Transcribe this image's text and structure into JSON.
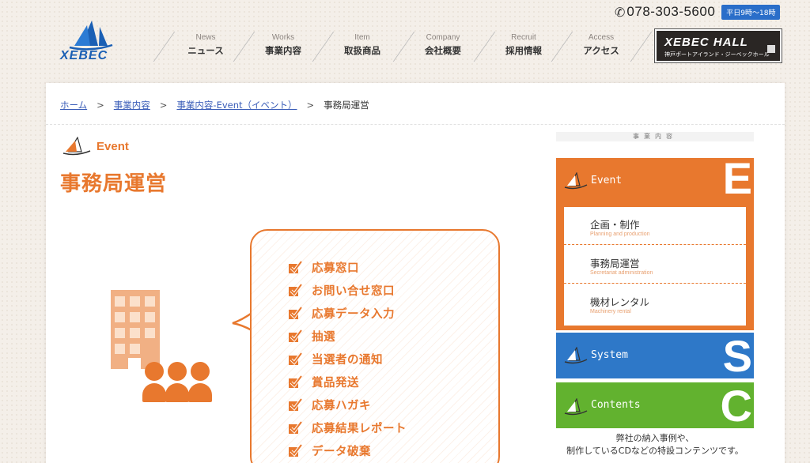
{
  "header": {
    "logo_text": "XEBEC",
    "phone": "078-303-5600",
    "hours": "平日9時～18時",
    "nav": [
      {
        "en": "News",
        "jp": "ニュース"
      },
      {
        "en": "Works",
        "jp": "事業内容"
      },
      {
        "en": "Item",
        "jp": "取扱商品"
      },
      {
        "en": "Company",
        "jp": "会社概要"
      },
      {
        "en": "Recruit",
        "jp": "採用情報"
      },
      {
        "en": "Access",
        "jp": "アクセス"
      }
    ],
    "hall": {
      "title": "XEBEC HALL",
      "sub": "神戸ポートアイランド・ジーベックホール"
    }
  },
  "breadcrumb": {
    "items": [
      "ホーム",
      "事業内容",
      "事業内容-Event（イベント）"
    ],
    "current": "事務局運営",
    "separator": ">"
  },
  "main": {
    "category": "Event",
    "title": "事務局運営",
    "checklist": [
      "応募窓口",
      "お問い合せ窓口",
      "応募データ入力",
      "抽選",
      "当選者の通知",
      "賞品発送",
      "応募ハガキ",
      "応募結果レポート",
      "データ破棄"
    ]
  },
  "sidebar": {
    "heading": "事業内容",
    "event": {
      "label": "Event",
      "letter": "E",
      "items": [
        {
          "jp": "企画・制作",
          "en": "Planning and production"
        },
        {
          "jp": "事務局運営",
          "en": "Secretariat administration"
        },
        {
          "jp": "機材レンタル",
          "en": "Machinery rental"
        }
      ]
    },
    "system": {
      "label": "System",
      "letter": "S"
    },
    "contents": {
      "label": "Contents",
      "letter": "C"
    },
    "desc_line1": "弊社の納入事例や、",
    "desc_line2": "制作しているCDなどの特設コンテンツです。"
  },
  "colors": {
    "accent": "#e8782e",
    "blue": "#2e78c8",
    "green": "#62b22f",
    "brand": "#1a5fb4"
  },
  "icons": [
    "phone-icon",
    "sailboat-icon",
    "check-icon",
    "hall-arrow-icon"
  ]
}
